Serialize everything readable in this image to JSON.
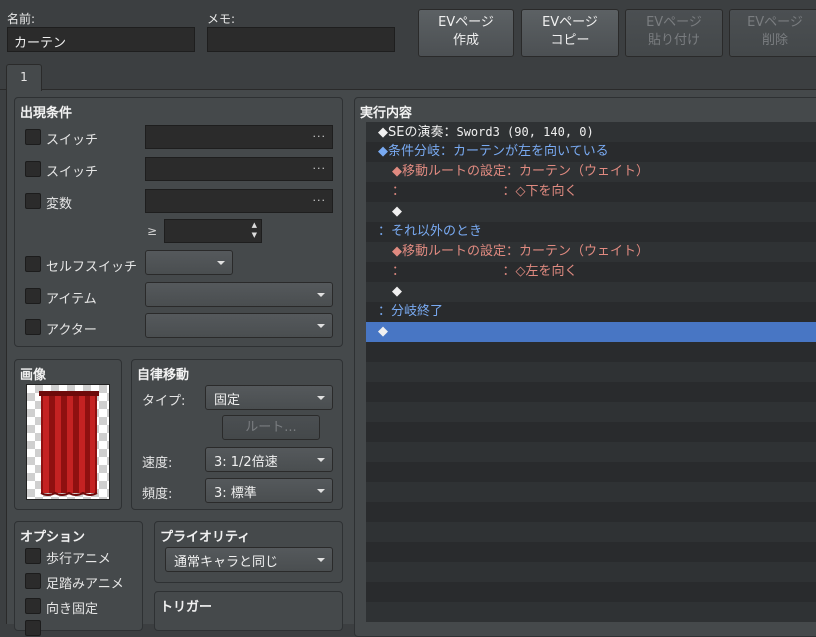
{
  "top": {
    "name_label": "名前:",
    "name_value": "カーテン",
    "memo_label": "メモ:",
    "memo_value": "",
    "buttons": [
      {
        "label": "EVページ\n作成",
        "enabled": true
      },
      {
        "label": "EVページ\nコピー",
        "enabled": true
      },
      {
        "label": "EVページ\n貼り付け",
        "enabled": false
      },
      {
        "label": "EVページ\n削除",
        "enabled": false
      }
    ]
  },
  "tabs": [
    {
      "label": "1"
    }
  ],
  "conditions": {
    "title": "出現条件",
    "switch1_label": "スイッチ",
    "switch2_label": "スイッチ",
    "variable_label": "変数",
    "gte_symbol": "≥",
    "self_switch_label": "セルフスイッチ",
    "item_label": "アイテム",
    "actor_label": "アクター",
    "more_glyph": "···"
  },
  "image": {
    "title": "画像"
  },
  "autonomous": {
    "title": "自律移動",
    "type_label": "タイプ:",
    "type_value": "固定",
    "route_button": "ルート...",
    "speed_label": "速度:",
    "speed_value": "3: 1/2倍速",
    "freq_label": "頻度:",
    "freq_value": "3: 標準"
  },
  "options": {
    "title": "オプション",
    "items": [
      {
        "label": "歩行アニメ",
        "checked": false
      },
      {
        "label": "足踏みアニメ",
        "checked": false
      },
      {
        "label": "向き固定",
        "checked": false
      }
    ]
  },
  "priority": {
    "title": "プライオリティ",
    "value": "通常キャラと同じ"
  },
  "trigger": {
    "title": "トリガー"
  },
  "contents": {
    "title": "実行内容",
    "rows": [
      {
        "indent": 0,
        "parts": [
          {
            "t": "◆SEの演奏：",
            "c": "white"
          },
          {
            "t": "Sword3 (90, 140, 0)",
            "c": "white",
            "mono": true
          }
        ]
      },
      {
        "indent": 0,
        "parts": [
          {
            "t": "◆条件分岐：カーテンが左を向いている",
            "c": "blue"
          }
        ]
      },
      {
        "indent": 1,
        "parts": [
          {
            "t": "◆移動ルートの設定：",
            "c": "red"
          },
          {
            "t": "カーテン（ウェイト）",
            "c": "red"
          }
        ]
      },
      {
        "indent": 1,
        "parts": [
          {
            "t": "：",
            "c": "red"
          },
          {
            "t": "：◇下を向く",
            "c": "red",
            "pad": true
          }
        ]
      },
      {
        "indent": 1,
        "parts": [
          {
            "t": "◆",
            "c": "white"
          }
        ]
      },
      {
        "indent": 0,
        "parts": [
          {
            "t": "：それ以外のとき",
            "c": "blue"
          }
        ]
      },
      {
        "indent": 1,
        "parts": [
          {
            "t": "◆移動ルートの設定：",
            "c": "red"
          },
          {
            "t": "カーテン（ウェイト）",
            "c": "red"
          }
        ]
      },
      {
        "indent": 1,
        "parts": [
          {
            "t": "：",
            "c": "red"
          },
          {
            "t": "：◇左を向く",
            "c": "red",
            "pad": true
          }
        ]
      },
      {
        "indent": 1,
        "parts": [
          {
            "t": "◆",
            "c": "white"
          }
        ]
      },
      {
        "indent": 0,
        "parts": [
          {
            "t": "：分岐終了",
            "c": "blue"
          }
        ]
      },
      {
        "indent": 0,
        "parts": [
          {
            "t": "◆",
            "c": "white"
          }
        ],
        "selected": true
      }
    ]
  },
  "colors": {
    "accent": "#4876c4",
    "blue_text": "#79aaf2",
    "red_text": "#e08a80",
    "curtain": "#b21a1a"
  }
}
